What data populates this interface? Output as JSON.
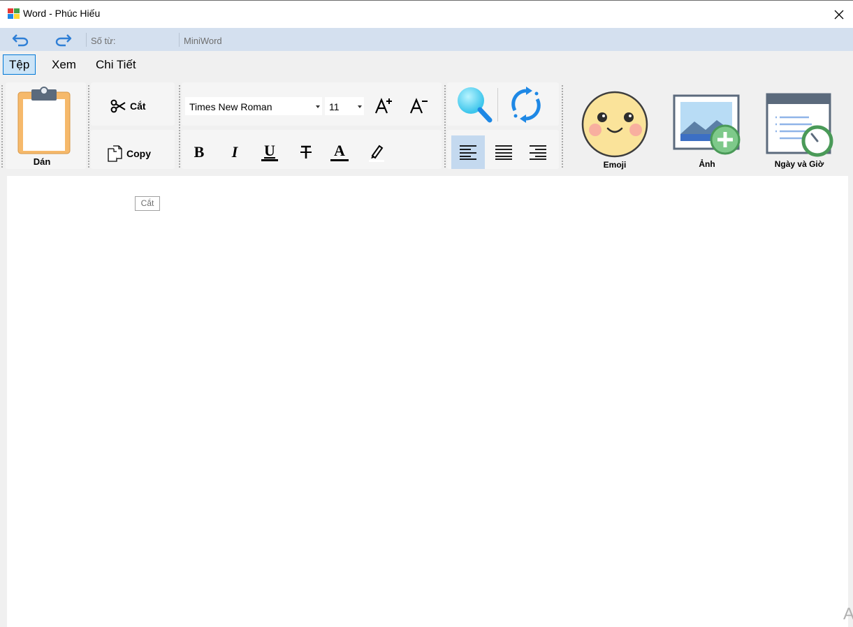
{
  "window": {
    "title": "Word - Phúc Hiếu",
    "close_icon": "close-icon"
  },
  "quickbar": {
    "undo_icon": "undo-icon",
    "redo_icon": "redo-icon",
    "word_count_label": "Số từ:",
    "app_label": "MiniWord"
  },
  "menu": {
    "items": [
      "Tệp",
      "Xem",
      "Chi Tiết"
    ],
    "active": "Tệp"
  },
  "ribbon": {
    "paste_label": "Dán",
    "cut_label": "Cắt",
    "copy_label": "Copy",
    "cut_tooltip": "Cắt",
    "font_name": "Times New Roman",
    "font_size": "11",
    "emoji_label": "Emoji",
    "image_label": "Ảnh",
    "datetime_label": "Ngày và Giờ",
    "selected_alignment": "align-left"
  },
  "colors": {
    "quickbar_bg": "#d4e0ef",
    "menu_active_bg": "#cce4f7",
    "menu_active_border": "#0078d7",
    "align_selected_bg": "#c4d9ef",
    "accent_blue": "#1e88e5"
  },
  "document": {
    "corner_glyph": "A"
  }
}
